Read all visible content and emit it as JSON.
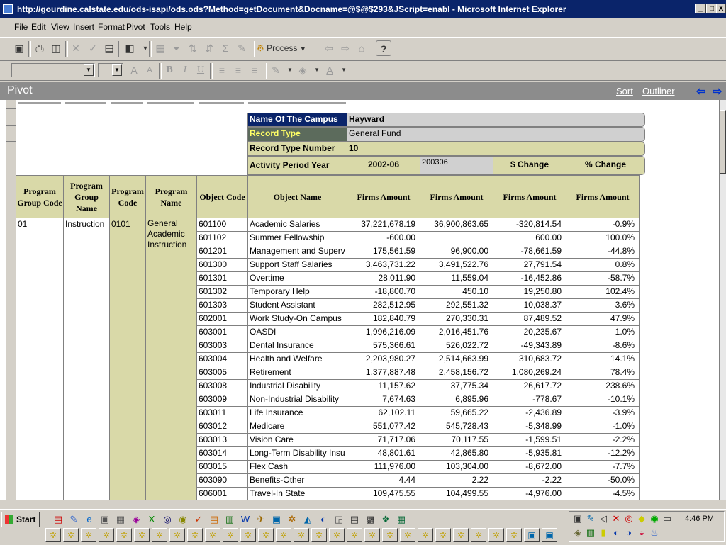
{
  "window": {
    "title": "http://gourdine.calstate.edu/ods-isapi/ods.ods?Method=getDocument&Docname=@$@$293&JScript=enabl - Microsoft Internet Explorer",
    "minimize": "_",
    "maximize": "□",
    "close": "X"
  },
  "menu": [
    "File",
    "Edit",
    "View",
    "Insert",
    "Format",
    "Pivot",
    "Tools",
    "Help"
  ],
  "toolbar": {
    "process_label": "Process",
    "help_label": "?"
  },
  "pivot_bar": {
    "title": "Pivot",
    "sort_link": "Sort",
    "outliner_link": "Outliner"
  },
  "filters": [
    {
      "label": "Name Of The Campus",
      "value": "Hayward"
    },
    {
      "label": "Record Type",
      "value": "General Fund"
    },
    {
      "label": "Record Type Number",
      "value": "10"
    }
  ],
  "activity": {
    "label": "Activity Period Year",
    "years": [
      "2002-06",
      "200306",
      "$ Change",
      "% Change"
    ]
  },
  "row_headers": [
    "Program Group Code",
    "Program Group Name",
    "Program Code",
    "Program Name",
    "Object Code",
    "Object Name"
  ],
  "measure_headers": [
    "Firms Amount",
    "Firms Amount",
    "Firms Amount",
    "Firms Amount"
  ],
  "group": {
    "program_group_code": "01",
    "program_group_name": "Instruction",
    "program_code": "0101",
    "program_name": "General Academic Instruction"
  },
  "rows": [
    {
      "code": "601100",
      "name": "Academic Salaries",
      "v1": "37,221,678.19",
      "v2": "36,900,863.65",
      "chg": "-320,814.54",
      "pct": "-0.9%"
    },
    {
      "code": "601102",
      "name": "Summer Fellowship",
      "v1": "-600.00",
      "v2": "",
      "chg": "600.00",
      "pct": "100.0%"
    },
    {
      "code": "601201",
      "name": "Management and Superv",
      "v1": "175,561.59",
      "v2": "96,900.00",
      "chg": "-78,661.59",
      "pct": "-44.8%"
    },
    {
      "code": "601300",
      "name": "Support Staff Salaries",
      "v1": "3,463,731.22",
      "v2": "3,491,522.76",
      "chg": "27,791.54",
      "pct": "0.8%"
    },
    {
      "code": "601301",
      "name": "Overtime",
      "v1": "28,011.90",
      "v2": "11,559.04",
      "chg": "-16,452.86",
      "pct": "-58.7%"
    },
    {
      "code": "601302",
      "name": "Temporary Help",
      "v1": "-18,800.70",
      "v2": "450.10",
      "chg": "19,250.80",
      "pct": "102.4%"
    },
    {
      "code": "601303",
      "name": "Student Assistant",
      "v1": "282,512.95",
      "v2": "292,551.32",
      "chg": "10,038.37",
      "pct": "3.6%"
    },
    {
      "code": "602001",
      "name": "Work Study-On Campus",
      "v1": "182,840.79",
      "v2": "270,330.31",
      "chg": "87,489.52",
      "pct": "47.9%"
    },
    {
      "code": "603001",
      "name": "OASDI",
      "v1": "1,996,216.09",
      "v2": "2,016,451.76",
      "chg": "20,235.67",
      "pct": "1.0%"
    },
    {
      "code": "603003",
      "name": "Dental Insurance",
      "v1": "575,366.61",
      "v2": "526,022.72",
      "chg": "-49,343.89",
      "pct": "-8.6%"
    },
    {
      "code": "603004",
      "name": "Health and Welfare",
      "v1": "2,203,980.27",
      "v2": "2,514,663.99",
      "chg": "310,683.72",
      "pct": "14.1%"
    },
    {
      "code": "603005",
      "name": "Retirement",
      "v1": "1,377,887.48",
      "v2": "2,458,156.72",
      "chg": "1,080,269.24",
      "pct": "78.4%"
    },
    {
      "code": "603008",
      "name": "Industrial Disability",
      "v1": "11,157.62",
      "v2": "37,775.34",
      "chg": "26,617.72",
      "pct": "238.6%"
    },
    {
      "code": "603009",
      "name": "Non-Industrial Disability",
      "v1": "7,674.63",
      "v2": "6,895.96",
      "chg": "-778.67",
      "pct": "-10.1%"
    },
    {
      "code": "603011",
      "name": "Life Insurance",
      "v1": "62,102.11",
      "v2": "59,665.22",
      "chg": "-2,436.89",
      "pct": "-3.9%"
    },
    {
      "code": "603012",
      "name": "Medicare",
      "v1": "551,077.42",
      "v2": "545,728.43",
      "chg": "-5,348.99",
      "pct": "-1.0%"
    },
    {
      "code": "603013",
      "name": "Vision Care",
      "v1": "71,717.06",
      "v2": "70,117.55",
      "chg": "-1,599.51",
      "pct": "-2.2%"
    },
    {
      "code": "603014",
      "name": "Long-Term Disability Insu",
      "v1": "48,801.61",
      "v2": "42,865.80",
      "chg": "-5,935.81",
      "pct": "-12.2%"
    },
    {
      "code": "603015",
      "name": "Flex Cash",
      "v1": "111,976.00",
      "v2": "103,304.00",
      "chg": "-8,672.00",
      "pct": "-7.7%"
    },
    {
      "code": "603090",
      "name": "Benefits-Other",
      "v1": "4.44",
      "v2": "2.22",
      "chg": "-2.22",
      "pct": "-50.0%"
    },
    {
      "code": "606001",
      "name": "Travel-In State",
      "v1": "109,475.55",
      "v2": "104,499.55",
      "chg": "-4,976.00",
      "pct": "-4.5%"
    }
  ],
  "taskbar": {
    "start_label": "Start",
    "clock": "4:46 PM"
  }
}
